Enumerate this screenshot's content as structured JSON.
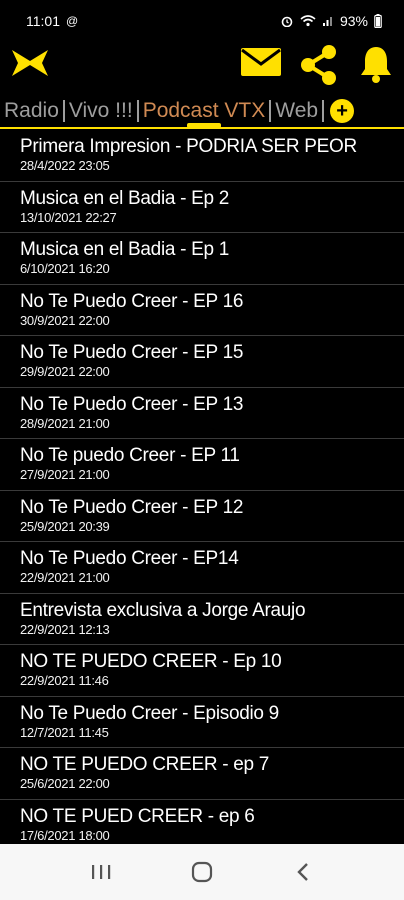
{
  "status": {
    "time": "11:01",
    "battery": "93%"
  },
  "header": {
    "logo_icon": "vtx-x-logo-icon",
    "actions": [
      "mail-icon",
      "share-icon",
      "bell-icon"
    ],
    "accent_color": "#ffe000"
  },
  "tabs": {
    "items": [
      "Radio",
      "Vivo !!!",
      "Podcast VTX",
      "Web"
    ],
    "active": "Podcast VTX",
    "add_icon": "plus-icon"
  },
  "podcasts": [
    {
      "title": "Primera Impresion - PODRIA SER PEOR",
      "date": "28/4/2022 23:05"
    },
    {
      "title": "Musica en el Badia - Ep 2",
      "date": "13/10/2021 22:27"
    },
    {
      "title": "Musica en el Badia - Ep 1",
      "date": "6/10/2021 16:20"
    },
    {
      "title": "No Te Puedo Creer - EP 16",
      "date": "30/9/2021 22:00"
    },
    {
      "title": "No Te Puedo Creer - EP 15",
      "date": "29/9/2021 22:00"
    },
    {
      "title": "No Te Puedo Creer - EP 13",
      "date": "28/9/2021 21:00"
    },
    {
      "title": "No Te puedo Creer - EP 11",
      "date": "27/9/2021 21:00"
    },
    {
      "title": "No Te Puedo Creer - EP 12",
      "date": "25/9/2021 20:39"
    },
    {
      "title": "No Te Puedo Creer - EP14",
      "date": "22/9/2021 21:00"
    },
    {
      "title": "Entrevista exclusiva a Jorge Araujo",
      "date": "22/9/2021 12:13"
    },
    {
      "title": "NO TE PUEDO CREER - Ep 10",
      "date": "22/9/2021 11:46"
    },
    {
      "title": "No Te Puedo Creer - Episodio 9",
      "date": "12/7/2021 11:45"
    },
    {
      "title": "NO TE PUEDO CREER - ep 7",
      "date": "25/6/2021 22:00"
    },
    {
      "title": "NO TE PUED CREER - ep 6",
      "date": "17/6/2021 18:00"
    }
  ],
  "navbar": [
    "recent-apps-icon",
    "home-icon",
    "back-icon"
  ]
}
